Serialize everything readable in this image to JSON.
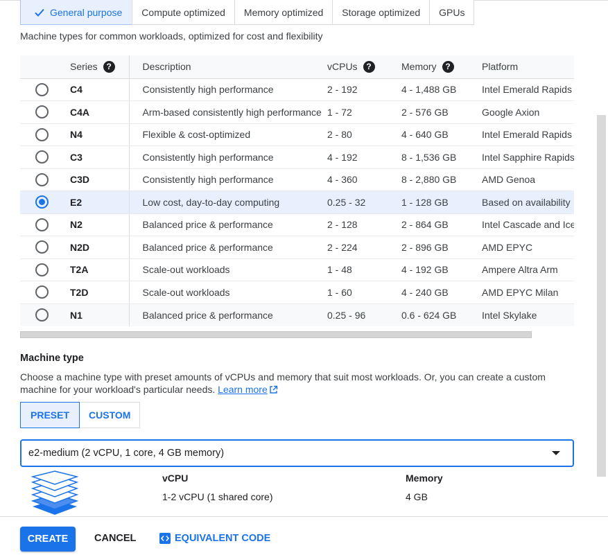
{
  "series_tabs": [
    {
      "label": "General purpose",
      "active": true
    },
    {
      "label": "Compute optimized",
      "active": false
    },
    {
      "label": "Memory optimized",
      "active": false
    },
    {
      "label": "Storage optimized",
      "active": false
    },
    {
      "label": "GPUs",
      "active": false
    }
  ],
  "subtitle": "Machine types for common workloads, optimized for cost and flexibility",
  "table": {
    "headers": {
      "series": "Series",
      "description": "Description",
      "vcpus": "vCPUs",
      "memory": "Memory",
      "platform": "Platform"
    },
    "rows": [
      {
        "series": "C4",
        "description": "Consistently high performance",
        "vcpus": "2 - 192",
        "memory": "4 - 1,488 GB",
        "platform": "Intel Emerald Rapids",
        "selected": false
      },
      {
        "series": "C4A",
        "description": "Arm-based consistently high performance",
        "vcpus": "1 - 72",
        "memory": "2 - 576 GB",
        "platform": "Google Axion",
        "selected": false
      },
      {
        "series": "N4",
        "description": "Flexible & cost-optimized",
        "vcpus": "2 - 80",
        "memory": "4 - 640 GB",
        "platform": "Intel Emerald Rapids",
        "selected": false
      },
      {
        "series": "C3",
        "description": "Consistently high performance",
        "vcpus": "4 - 192",
        "memory": "8 - 1,536 GB",
        "platform": "Intel Sapphire Rapids",
        "selected": false
      },
      {
        "series": "C3D",
        "description": "Consistently high performance",
        "vcpus": "4 - 360",
        "memory": "8 - 2,880 GB",
        "platform": "AMD Genoa",
        "selected": false
      },
      {
        "series": "E2",
        "description": "Low cost, day-to-day computing",
        "vcpus": "0.25 - 32",
        "memory": "1 - 128 GB",
        "platform": "Based on availability",
        "selected": true
      },
      {
        "series": "N2",
        "description": "Balanced price & performance",
        "vcpus": "2 - 128",
        "memory": "2 - 864 GB",
        "platform": "Intel Cascade and Ice Lake",
        "selected": false
      },
      {
        "series": "N2D",
        "description": "Balanced price & performance",
        "vcpus": "2 - 224",
        "memory": "2 - 896 GB",
        "platform": "AMD EPYC",
        "selected": false
      },
      {
        "series": "T2A",
        "description": "Scale-out workloads",
        "vcpus": "1 - 48",
        "memory": "4 - 192 GB",
        "platform": "Ampere Altra Arm",
        "selected": false
      },
      {
        "series": "T2D",
        "description": "Scale-out workloads",
        "vcpus": "1 - 60",
        "memory": "4 - 240 GB",
        "platform": "AMD EPYC Milan",
        "selected": false
      },
      {
        "series": "N1",
        "description": "Balanced price & performance",
        "vcpus": "0.25 - 96",
        "memory": "0.6 - 624 GB",
        "platform": "Intel Skylake",
        "selected": false
      }
    ]
  },
  "machine_type": {
    "title": "Machine type",
    "description": "Choose a machine type with preset amounts of vCPUs and memory that suit most workloads. Or, you can create a custom machine for your workload's particular needs.",
    "learn_more": "Learn more",
    "preset_label": "PRESET",
    "custom_label": "CUSTOM",
    "selected_value": "e2-medium (2 vCPU, 1 core, 4 GB memory)",
    "vcpu_header": "vCPU",
    "vcpu_value": "1-2 vCPU (1 shared core)",
    "memory_header": "Memory",
    "memory_value": "4 GB"
  },
  "footer": {
    "create": "CREATE",
    "cancel": "CANCEL",
    "equivalent_code": "EQUIVALENT CODE"
  },
  "colors": {
    "accent": "#1a73e8",
    "selected_row": "#e8f0fe"
  }
}
